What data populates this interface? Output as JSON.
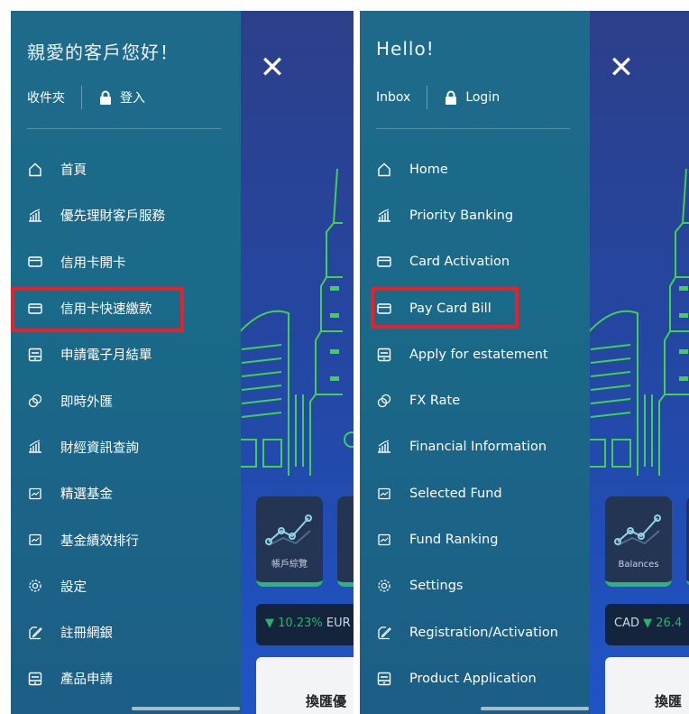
{
  "zh": {
    "greeting": "親愛的客戶您好！",
    "inbox": "收件夾",
    "login": "登入",
    "menu": [
      {
        "icon": "home-icon",
        "label": "首頁"
      },
      {
        "icon": "chart-icon",
        "label": "優先理財客戶服務"
      },
      {
        "icon": "card-icon",
        "label": "信用卡開卡"
      },
      {
        "icon": "card-icon",
        "label": "信用卡快速繳款"
      },
      {
        "icon": "statement-icon",
        "label": "申請電子月結單"
      },
      {
        "icon": "fx-icon",
        "label": "即時外匯"
      },
      {
        "icon": "chart-icon",
        "label": "財經資訊查詢"
      },
      {
        "icon": "fund-icon",
        "label": "精選基金"
      },
      {
        "icon": "fund-icon",
        "label": "基金績效排行"
      },
      {
        "icon": "gear-icon",
        "label": "設定"
      },
      {
        "icon": "register-icon",
        "label": "註冊網銀"
      },
      {
        "icon": "statement-icon",
        "label": "產品申請"
      }
    ],
    "tile_label": "帳戶綜覽",
    "ticker_arrow": "▼",
    "ticker_value": "10.23%",
    "ticker_currency": "EUR",
    "fx_card": "換匯優"
  },
  "en": {
    "greeting": "Hello!",
    "inbox": "Inbox",
    "login": "Login",
    "menu": [
      {
        "icon": "home-icon",
        "label": "Home"
      },
      {
        "icon": "chart-icon",
        "label": "Priority Banking"
      },
      {
        "icon": "card-icon",
        "label": "Card Activation"
      },
      {
        "icon": "card-icon",
        "label": "Pay Card Bill"
      },
      {
        "icon": "statement-icon",
        "label": "Apply for estatement"
      },
      {
        "icon": "fx-icon",
        "label": "FX Rate"
      },
      {
        "icon": "chart-icon",
        "label": "Financial Information"
      },
      {
        "icon": "fund-icon",
        "label": "Selected Fund"
      },
      {
        "icon": "fund-icon",
        "label": "Fund Ranking"
      },
      {
        "icon": "gear-icon",
        "label": "Settings"
      },
      {
        "icon": "register-icon",
        "label": "Registration/Activation"
      },
      {
        "icon": "statement-icon",
        "label": "Product Application"
      }
    ],
    "tile_label": "Balances",
    "ticker_currency": "CAD",
    "ticker_arrow": "▼",
    "ticker_value": "26.4",
    "fx_card": "換匯"
  },
  "close_glyph": "✕",
  "colors": {
    "highlight": "#e8202a",
    "drawer": "#1a6a89",
    "accent_green": "#2bb673"
  }
}
